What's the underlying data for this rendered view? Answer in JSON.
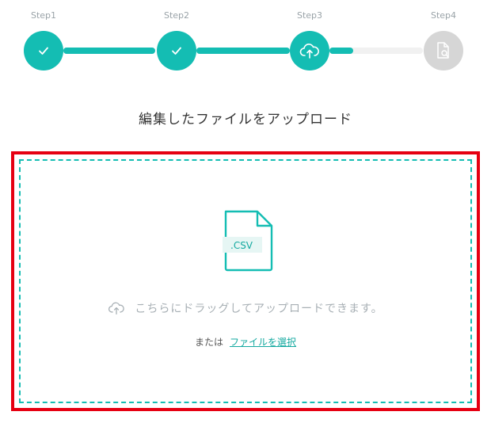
{
  "stepper": {
    "steps": [
      {
        "label": "Step1",
        "status": "done",
        "icon": "check-icon"
      },
      {
        "label": "Step2",
        "status": "done",
        "icon": "check-icon"
      },
      {
        "label": "Step3",
        "status": "current",
        "icon": "cloud-upload-icon"
      },
      {
        "label": "Step4",
        "status": "pending",
        "icon": "document-search-icon"
      }
    ],
    "connector_progress": [
      1.0,
      1.0,
      0.25
    ]
  },
  "page": {
    "title": "編集したファイルをアップロード"
  },
  "dropzone": {
    "file_type_label": ".CSV",
    "drop_text": "こちらにドラッグしてアップロードできます。",
    "or_text": "または",
    "select_link": "ファイルを選択"
  },
  "colors": {
    "accent": "#14bdb3",
    "pending": "#d6d6d6",
    "highlight": "#e60012"
  }
}
